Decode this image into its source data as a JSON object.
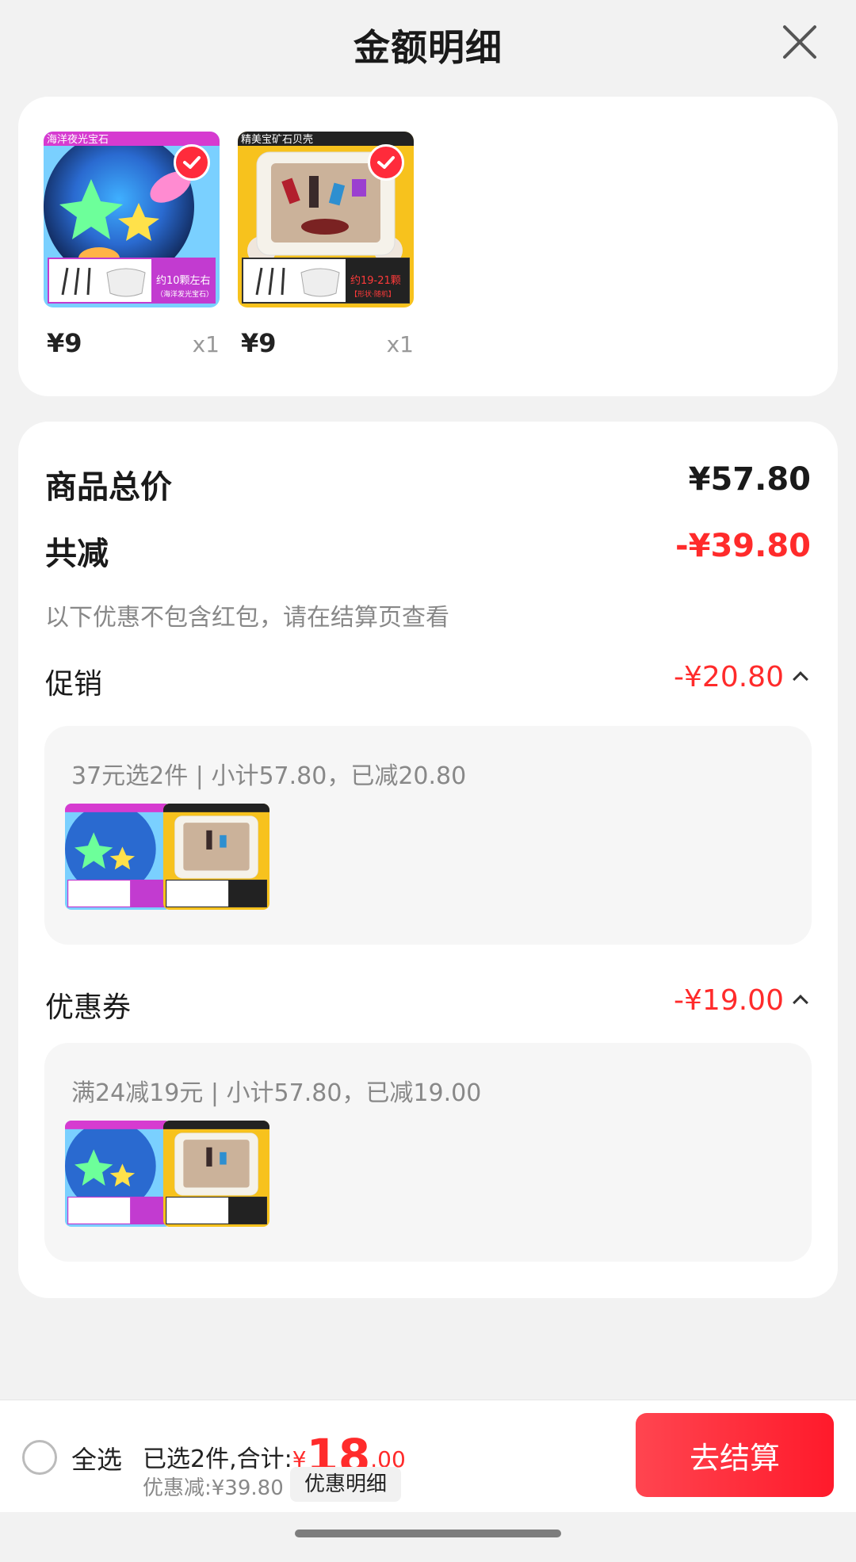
{
  "header": {
    "title": "金额明细"
  },
  "products": [
    {
      "banner": "海洋夜光宝石",
      "tag": "约10颗左右",
      "sub": "（海洋发光宝石）",
      "price": "¥9",
      "qty": "x1"
    },
    {
      "banner": "精美宝矿石贝壳",
      "tag": "约19-21颗",
      "sub": "【形状·随机】",
      "price": "¥9",
      "qty": "x1"
    }
  ],
  "summary": {
    "total_label": "商品总价",
    "total_value": "¥57.80",
    "reduce_label": "共减",
    "reduce_value": "-¥39.80",
    "note": "以下优惠不包含红包，请在结算页查看"
  },
  "promotions": [
    {
      "label": "促销",
      "value": "-¥20.80",
      "detail": "37元选2件 | 小计57.80，已减20.80"
    },
    {
      "label": "优惠券",
      "value": "-¥19.00",
      "detail": "满24减19元 | 小计57.80，已减19.00"
    }
  ],
  "bottom": {
    "select_all": "全选",
    "selected_prefix": "已选2件,合计:",
    "currency": "¥",
    "amount_int": "18",
    "amount_dec": ".00",
    "discount": "优惠减:¥39.80",
    "detail_chip": "优惠明细",
    "checkout": "去结算"
  },
  "colors": {
    "accent": "#ff2b2b",
    "button": "#ff1a2b"
  }
}
